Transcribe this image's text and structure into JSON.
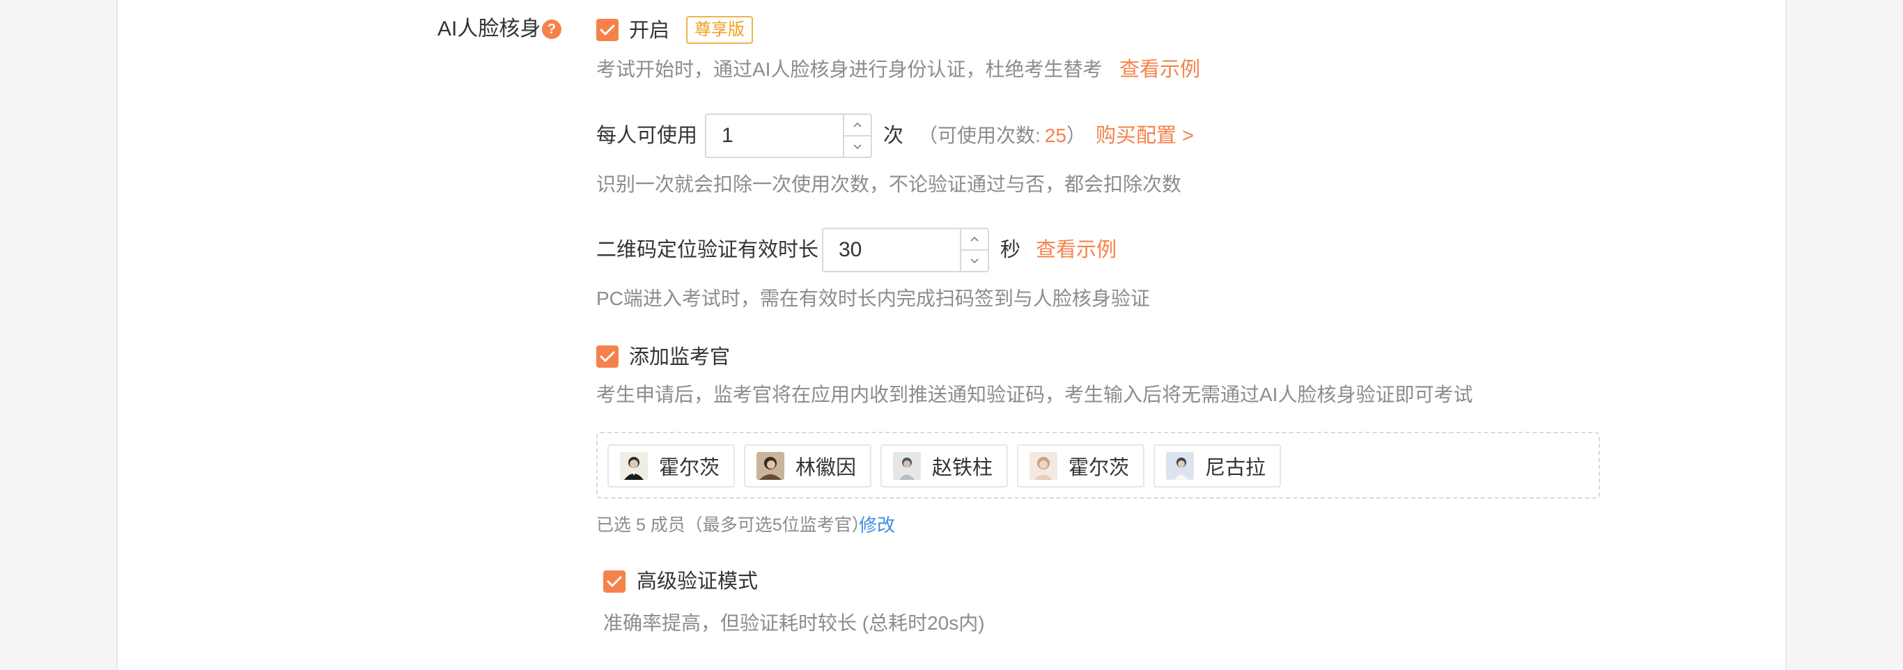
{
  "section_label": "AI人脸核身",
  "help_symbol": "?",
  "enable": {
    "label": "开启",
    "checked": true,
    "badge": "尊享版"
  },
  "enable_desc": "考试开始时，通过AI人脸核身进行身份认证，杜绝考生替考",
  "view_example": "查看示例",
  "per_person": {
    "label": "每人可使用",
    "value": "1",
    "unit": "次",
    "available_prefix": "（可使用次数:",
    "available_count": "25",
    "available_suffix": "）",
    "buy_link": "购买配置 >"
  },
  "per_person_desc": "识别一次就会扣除一次使用次数，不论验证通过与否，都会扣除次数",
  "qr_duration": {
    "label": "二维码定位验证有效时长",
    "value": "30",
    "unit": "秒",
    "example_link": "查看示例"
  },
  "qr_desc": "PC端进入考试时，需在有效时长内完成扫码签到与人脸核身验证",
  "proctor": {
    "label": "添加监考官",
    "checked": true
  },
  "proctor_desc": "考生申请后，监考官将在应用内收到推送通知验证码，考生输入后将无需通过AI人脸核身验证即可考试",
  "proctors": [
    {
      "name": "霍尔茨"
    },
    {
      "name": "林徽因"
    },
    {
      "name": "赵铁柱"
    },
    {
      "name": "霍尔茨"
    },
    {
      "name": "尼古拉"
    }
  ],
  "selected_info": "已选 5 成员（最多可选5位监考官）",
  "modify_link": "修改",
  "advanced": {
    "label": "高级验证模式",
    "checked": true
  },
  "advanced_desc": "准确率提高，但验证耗时较长 (总耗时20s内)",
  "colors": {
    "accent": "#f5824a",
    "link_blue": "#3d8ee6",
    "badge": "#f0a020"
  }
}
